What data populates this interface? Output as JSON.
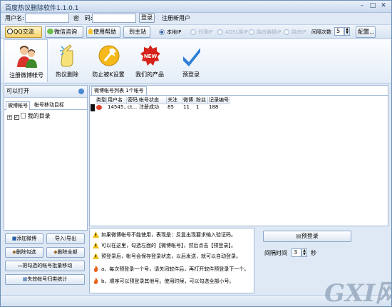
{
  "window": {
    "title": "百度热议删除软件1.1.0.1",
    "min": "–",
    "max": "□",
    "close": "✕"
  },
  "login": {
    "user_label": "用户名:",
    "user_value": "",
    "pass_label": "密　码:",
    "pass_value": "",
    "login_btn": "登录",
    "register_link": "注册新用户"
  },
  "toolbar": {
    "qq_btn": "QQ交流",
    "wechat_btn": "微信咨询",
    "help_btn": "使用帮助",
    "home_btn": "到主站",
    "proxy_options": [
      {
        "label": "本地IP",
        "selected": true,
        "disabled": false
      },
      {
        "label": "代理IP",
        "selected": false,
        "disabled": true
      },
      {
        "label": "ADSL换IP",
        "selected": false,
        "disabled": true
      },
      {
        "label": "路由器换IP",
        "selected": false,
        "disabled": true
      },
      {
        "label": "路由IP",
        "selected": false,
        "disabled": true
      }
    ],
    "switch_label": "间隔次数",
    "switch_value": "5",
    "config_btn": "配置..."
  },
  "ribbon": [
    {
      "label": "注册微博帐号",
      "icon": "users-icon",
      "selected": true
    },
    {
      "label": "热议删除",
      "icon": "hand-pointer-icon",
      "selected": false
    },
    {
      "label": "防止被K设置",
      "icon": "wrench-icon",
      "selected": false
    },
    {
      "label": "我们的产品",
      "icon": "new-badge-icon",
      "selected": false
    },
    {
      "label": "预登录",
      "icon": "checkmark-icon",
      "selected": false
    }
  ],
  "left": {
    "header": "可以打开",
    "tabs": [
      "微博帐号",
      "帐号移动目标"
    ],
    "tree_item": "我的目录",
    "buttons": {
      "add": "添加微博",
      "import_export": "导入\\导出",
      "delete_checked": "删除勾选",
      "delete_all": "删除全部",
      "move_checked": "把勾选的帐号批量移动",
      "fail_stats": "失效帐号归类统计"
    }
  },
  "main": {
    "tab": "微博帐号列表 1个帐号",
    "columns": [
      "类型",
      "用户名",
      "密码",
      "帐号状态",
      "关注",
      "微博",
      "粉丝",
      "记录编号"
    ],
    "rows": [
      {
        "type": "weibo-icon",
        "user": "14545...",
        "pass": "ct...",
        "status": "注册成功",
        "follow": "85",
        "weibo": "11",
        "fans": "1",
        "id": "188"
      }
    ]
  },
  "tips": [
    {
      "icon": "warning-icon",
      "text": "如果微博帐号不能使用，表现是：反复出现要求输入验证码。"
    },
    {
      "icon": "warning-icon",
      "text": "可以在这里，勾选左面的【微博帐号】，然后点击【预登录】。"
    },
    {
      "icon": "warning-icon",
      "text": "预登录后，帐号会保存登录状态，以后发送，就可以自动登录。"
    },
    {
      "icon": "fire-icon",
      "text": "a、每次预登录一个号，请关闭软件后，再打开软件预登录下一个。"
    },
    {
      "icon": "fire-icon",
      "text": "b、顺序可以预登录其他号。使用时候，可以勾选全部小号。"
    }
  ],
  "prelogin": {
    "button": "预登录",
    "interval_label": "间隔时间",
    "interval_value": "3",
    "unit": "秒"
  },
  "watermark": {
    "text": "GXI网"
  },
  "colors": {
    "accent": "#2a5ea8",
    "frame": "#dfe9f5",
    "border": "#9eb5d4"
  }
}
